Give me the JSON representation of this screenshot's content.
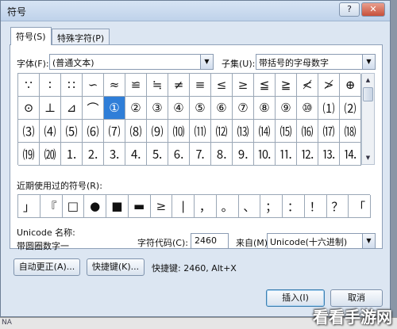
{
  "window": {
    "title": "符号",
    "help_label": "?",
    "close_label": "✕"
  },
  "tabs": [
    {
      "label": "符号(S)",
      "active": true
    },
    {
      "label": "特殊字符(P)",
      "active": false
    }
  ],
  "font": {
    "label": "字体(F):",
    "value": "(普通文本)"
  },
  "subset": {
    "label": "子集(U):",
    "value": "带括号的字母数字"
  },
  "symbols": [
    [
      "∵",
      "∶",
      "∷",
      "∽",
      "≈",
      "≌",
      "≒",
      "≠",
      "≡",
      "≤",
      "≥",
      "≦",
      "≧",
      "≮",
      "≯",
      "⊕"
    ],
    [
      "⊙",
      "⊥",
      "⊿",
      "⌒",
      "①",
      "②",
      "③",
      "④",
      "⑤",
      "⑥",
      "⑦",
      "⑧",
      "⑨",
      "⑩",
      "⑴",
      "⑵"
    ],
    [
      "⑶",
      "⑷",
      "⑸",
      "⑹",
      "⑺",
      "⑻",
      "⑼",
      "⑽",
      "⑾",
      "⑿",
      "⒀",
      "⒁",
      "⒂",
      "⒃",
      "⒄",
      "⒅"
    ],
    [
      "⒆",
      "⒇",
      "⒈",
      "⒉",
      "⒊",
      "⒋",
      "⒌",
      "⒍",
      "⒎",
      "⒏",
      "⒐",
      "⒑",
      "⒒",
      "⒓",
      "⒔",
      "⒕"
    ]
  ],
  "selected_symbol": "①",
  "recent": {
    "label": "近期使用过的符号(R):",
    "symbols": [
      "」",
      "『",
      "□",
      "●",
      "■",
      "▬",
      "≥",
      "|",
      "，",
      "。",
      "、",
      "；",
      "：",
      "！",
      "？",
      "「"
    ]
  },
  "unicode_name": {
    "label": "Unicode 名称:",
    "value": "带圆圈数字一"
  },
  "char_code": {
    "label": "字符代码(C):",
    "value": "2460"
  },
  "from": {
    "label": "来自(M):",
    "value": "Unicode(十六进制)"
  },
  "buttons": {
    "autocorrect": "自动更正(A)...",
    "shortcut": "快捷键(K)...",
    "insert": "插入(I)",
    "cancel": "取消"
  },
  "shortcut_text": "快捷键: 2460, Alt+X",
  "bottom_strip_text": "NA",
  "watermark": "看看手游网"
}
